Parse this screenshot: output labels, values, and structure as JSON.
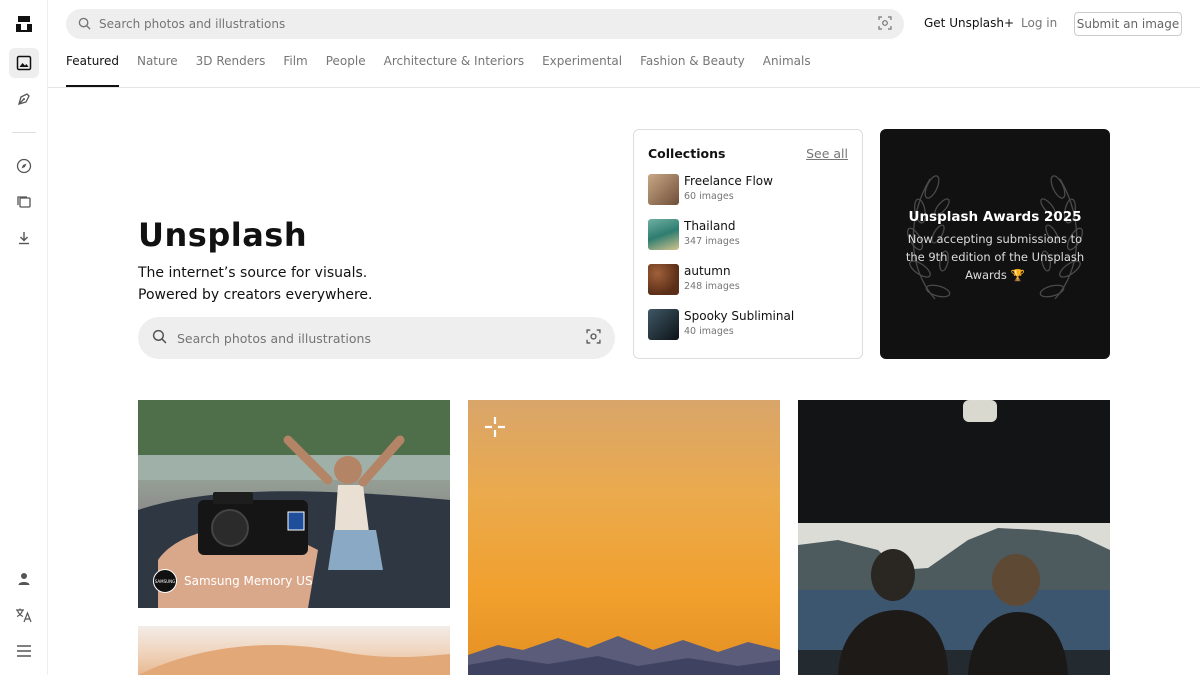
{
  "top": {
    "search_placeholder": "Search photos and illustrations",
    "get_plus": "Get Unsplash+",
    "login": "Log in",
    "submit": "Submit an image"
  },
  "rail": {
    "icons": [
      "unsplash-logo-icon",
      "photos-icon",
      "illustrations-icon",
      "explore-icon",
      "collections-icon",
      "download-icon",
      "user-icon",
      "language-icon",
      "menu-icon"
    ]
  },
  "tabs": [
    "Featured",
    "Nature",
    "3D Renders",
    "Film",
    "People",
    "Architecture & Interiors",
    "Experimental",
    "Fashion & Beauty",
    "Animals"
  ],
  "hero": {
    "title": "Unsplash",
    "line1": "The internet’s source for visuals.",
    "line2": "Powered by creators everywhere.",
    "search_placeholder": "Search photos and illustrations"
  },
  "collections": {
    "heading": "Collections",
    "see_all": "See all",
    "items": [
      {
        "name": "Freelance Flow",
        "count": "60 images",
        "color": "#8a6a4e"
      },
      {
        "name": "Thailand",
        "count": "347 images",
        "color": "#3f8f86"
      },
      {
        "name": "autumn",
        "count": "248 images",
        "color": "#6e3d22"
      },
      {
        "name": "Spooky Subliminal",
        "count": "40 images",
        "color": "#1e2a33"
      }
    ]
  },
  "awards": {
    "title": "Unsplash Awards 2025",
    "desc": "Now accepting submissions to the 9th edition of the Unsplash Awards 🏆"
  },
  "photos": {
    "author1": "Samsung Memory US",
    "author1_logo": "SAMSUNG"
  }
}
